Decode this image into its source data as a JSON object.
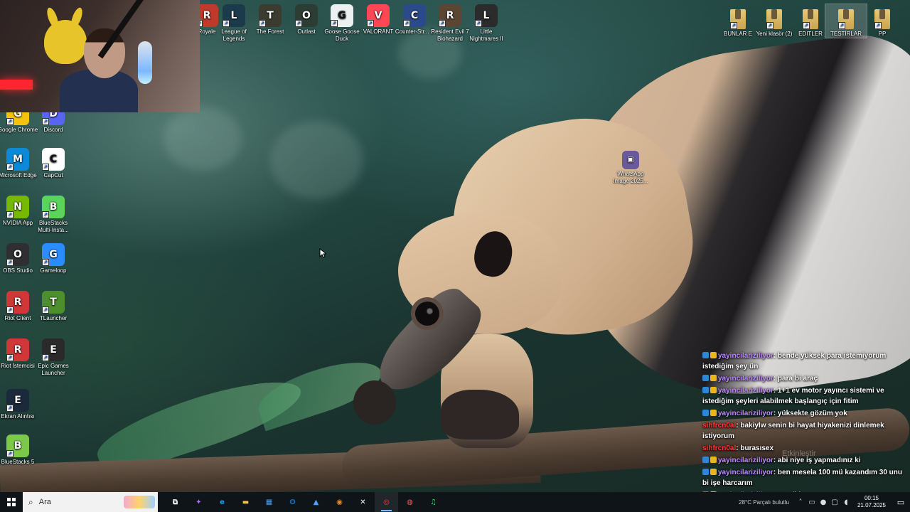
{
  "desktop": {
    "top_icons": [
      {
        "label": "Royale",
        "icon": "clash-royale-icon",
        "color": "#c0392b"
      },
      {
        "label": "League of Legends",
        "icon": "league-of-legends-icon",
        "color": "#1b3a4b"
      },
      {
        "label": "The Forest",
        "icon": "the-forest-icon",
        "color": "#3b3b2f"
      },
      {
        "label": "Outlast",
        "icon": "outlast-icon",
        "color": "#2c3e33"
      },
      {
        "label": "Goose Goose Duck",
        "icon": "goose-goose-duck-icon",
        "color": "#ecf0f1"
      },
      {
        "label": "VALORANT",
        "icon": "valorant-icon",
        "color": "#ff4655"
      },
      {
        "label": "Counter-Str... 2",
        "icon": "counter-strike-2-icon",
        "color": "#2a4a8a"
      },
      {
        "label": "Resident Evil 7 Biohazard",
        "icon": "resident-evil-7-icon",
        "color": "#5a4632"
      },
      {
        "label": "Little Nightmares II",
        "icon": "little-nightmares-2-icon",
        "color": "#2b2b2b"
      }
    ],
    "folders": [
      {
        "label": "BUNLAR E",
        "icon": "folder-icon"
      },
      {
        "label": "Yeni klasör (2)",
        "icon": "folder-icon"
      },
      {
        "label": "EDITLER",
        "icon": "folder-icon"
      },
      {
        "label": "TESTİRLAR",
        "icon": "folder-icon",
        "selected": true
      },
      {
        "label": "PP",
        "icon": "folder-icon"
      }
    ],
    "left_icons": [
      {
        "label": "Google Chrome",
        "icon": "chrome-icon",
        "color": "#f4c20d"
      },
      {
        "label": "Discord",
        "icon": "discord-icon",
        "color": "#5865f2"
      },
      {
        "label": "Microsoft Edge",
        "icon": "edge-icon",
        "color": "#0c8ad8"
      },
      {
        "label": "CapCut",
        "icon": "capcut-icon",
        "color": "#ffffff"
      },
      {
        "label": "NVIDIA App",
        "icon": "nvidia-icon",
        "color": "#76b900"
      },
      {
        "label": "BlueStacks Multi-Insta...",
        "icon": "bluestacks-multi-icon",
        "color": "#5bd45b"
      },
      {
        "label": "OBS Studio",
        "icon": "obs-icon",
        "color": "#302e31"
      },
      {
        "label": "Gameloop",
        "icon": "gameloop-icon",
        "color": "#2a8cff"
      },
      {
        "label": "Riot Client",
        "icon": "riot-client-icon",
        "color": "#d13639"
      },
      {
        "label": "TLauncher",
        "icon": "tlauncher-icon",
        "color": "#4c8f2c"
      },
      {
        "label": "Riot İstemcisi",
        "icon": "riot-istemcisi-icon",
        "color": "#d13639"
      },
      {
        "label": "Epic Games Launcher",
        "icon": "epic-games-icon",
        "color": "#2a2a2a"
      },
      {
        "label": "Ekran Alıntısı",
        "icon": "snipping-tool-icon",
        "color": "#1b2a3a"
      },
      {
        "label": "BlueStacks 5",
        "icon": "bluestacks-5-icon",
        "color": "#7cc94a"
      }
    ],
    "file_icon": {
      "label": "WhatsApp Image 2025...",
      "icon": "image-file-icon"
    }
  },
  "chat": [
    {
      "user": "yayincilariziliyor",
      "text": ": bende yüksek para istemiyorum istediğim şey ün",
      "user_color": "purple"
    },
    {
      "user": "yayincilariziliyor",
      "text": ": para bi araç",
      "user_color": "purple"
    },
    {
      "user": "yayincilariziliyor",
      "text": ": 1+1 ev motor yayıncı sistemi ve istediğim şeyleri alabilmek başlangıç için fitim",
      "user_color": "purple"
    },
    {
      "user": "yayincilariziliyor",
      "text": ": yüksekte gözüm yok",
      "user_color": "purple"
    },
    {
      "user": "sihfrcn0al",
      "text": ": bakiylw senin bi hayat hiyakenizi dinlemek istiyorum",
      "user_color": "red"
    },
    {
      "user": "sihfrcn0al",
      "text": ": burasısex",
      "user_color": "red"
    },
    {
      "user": "yayincilariziliyor",
      "text": ": abi niye iş yapmadınız ki",
      "user_color": "purple"
    },
    {
      "user": "yayincilariziliyor",
      "text": ": ben mesela 100 mü kazandım 30 unu bi işe harcarım",
      "user_color": "purple"
    },
    {
      "user": "yayincilariziliyor",
      "text": ": ne gibi",
      "user_color": "purple"
    }
  ],
  "chat_ghost": "Etkinleştir",
  "taskbar": {
    "search_placeholder": "Ara",
    "apps": [
      {
        "name": "task-view",
        "glyph": "⧉",
        "color": "#ffffff"
      },
      {
        "name": "copilot",
        "glyph": "✦",
        "color": "#b06cff"
      },
      {
        "name": "edge",
        "glyph": "e",
        "color": "#1fa0e6"
      },
      {
        "name": "file-explorer",
        "glyph": "▬",
        "color": "#f5c542"
      },
      {
        "name": "store",
        "glyph": "▦",
        "color": "#3ba2ff"
      },
      {
        "name": "outlook",
        "glyph": "O",
        "color": "#0f6cbd"
      },
      {
        "name": "app-blue",
        "glyph": "▲",
        "color": "#4aa3ff"
      },
      {
        "name": "blender",
        "glyph": "◉",
        "color": "#f08a24"
      },
      {
        "name": "capcut",
        "glyph": "✕",
        "color": "#ffffff"
      },
      {
        "name": "chrome",
        "glyph": "◎",
        "color": "#e94235",
        "active": true
      },
      {
        "name": "obs",
        "glyph": "◍",
        "color": "#ff5555"
      },
      {
        "name": "spotify",
        "glyph": "♫",
        "color": "#1ed760"
      }
    ],
    "weather": "28°C  Parçalı bulutlu",
    "time": "00:15",
    "date": "21.07.2025"
  }
}
